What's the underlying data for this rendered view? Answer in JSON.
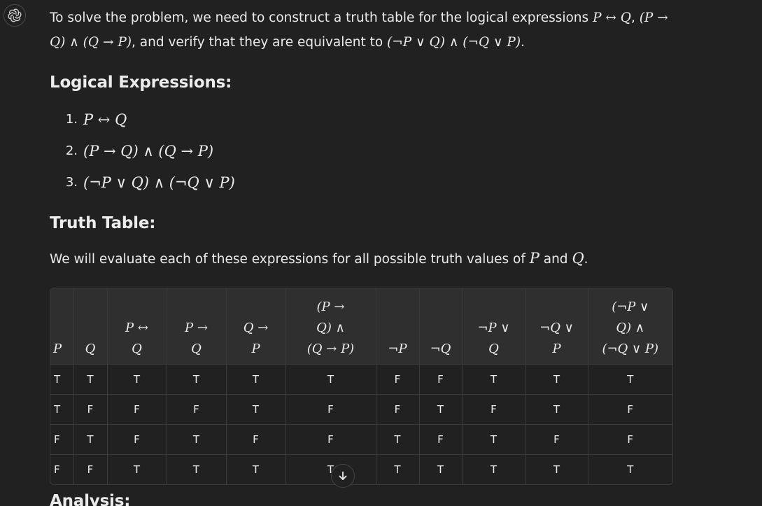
{
  "assistant": {
    "avatar_icon": "openai-logo-icon"
  },
  "intro": {
    "part1": "To solve the problem, we need to construct a truth table for the logical expressions ",
    "expr_a": "P ↔ Q",
    "sep1": ", ",
    "expr_b": "(P → Q) ∧ (Q → P)",
    "part2": ", and verify that they are equivalent to ",
    "expr_c": "(¬P ∨ Q) ∧ (¬Q ∨ P)",
    "part3": "."
  },
  "sections": {
    "logical_title": "Logical Expressions:",
    "truth_title": "Truth Table:",
    "analysis_title": "Analysis:"
  },
  "expressions": [
    {
      "num": "1.",
      "expr": "P ↔ Q"
    },
    {
      "num": "2.",
      "expr": "(P → Q) ∧ (Q → P)"
    },
    {
      "num": "3.",
      "expr": "(¬P ∨ Q) ∧ (¬Q ∨ P)"
    }
  ],
  "description": {
    "part1": "We will evaluate each of these expressions for all possible truth values of ",
    "p": "P",
    "mid": " and ",
    "q": "Q",
    "end": "."
  },
  "table": {
    "headers": [
      [
        "P"
      ],
      [
        "Q"
      ],
      [
        "P ↔",
        "Q"
      ],
      [
        "P →",
        "Q"
      ],
      [
        "Q →",
        "P"
      ],
      [
        "(P →",
        "Q) ∧",
        "(Q → P)"
      ],
      [
        "¬P"
      ],
      [
        "¬Q"
      ],
      [
        "¬P ∨",
        "Q"
      ],
      [
        "¬Q ∨",
        "P"
      ],
      [
        "(¬P ∨",
        "Q) ∧",
        "(¬Q ∨ P)"
      ]
    ],
    "rows": [
      [
        "T",
        "T",
        "T",
        "T",
        "T",
        "T",
        "F",
        "F",
        "T",
        "T",
        "T"
      ],
      [
        "T",
        "F",
        "F",
        "F",
        "T",
        "F",
        "F",
        "T",
        "F",
        "T",
        "F"
      ],
      [
        "F",
        "T",
        "F",
        "T",
        "F",
        "F",
        "T",
        "F",
        "T",
        "F",
        "F"
      ],
      [
        "F",
        "F",
        "T",
        "T",
        "T",
        "T",
        "T",
        "T",
        "T",
        "T",
        "T"
      ]
    ]
  },
  "scroll_button": {
    "icon": "arrow-down-icon"
  }
}
